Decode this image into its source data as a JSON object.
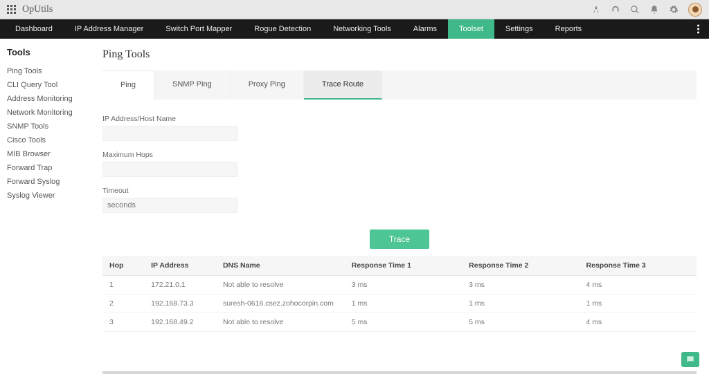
{
  "brand": "OpUtils",
  "nav": {
    "items": [
      "Dashboard",
      "IP Address Manager",
      "Switch Port Mapper",
      "Rogue Detection",
      "Networking Tools",
      "Alarms",
      "Toolset",
      "Settings",
      "Reports"
    ],
    "activeIndex": 6
  },
  "sidebar": {
    "title": "Tools",
    "items": [
      "Ping Tools",
      "CLI Query Tool",
      "Address Monitoring",
      "Network Monitoring",
      "SNMP Tools",
      "Cisco Tools",
      "MIB Browser",
      "Forward Trap",
      "Forward Syslog",
      "Syslog Viewer"
    ]
  },
  "page": {
    "title": "Ping Tools",
    "tabs": [
      "Ping",
      "SNMP Ping",
      "Proxy Ping",
      "Trace Route"
    ],
    "activeTab": 3
  },
  "form": {
    "ip_label": "IP Address/Host Name",
    "ip_value": "",
    "hops_label": "Maximum Hops",
    "hops_value": "",
    "timeout_label": "Timeout",
    "timeout_placeholder": "seconds",
    "trace_label": "Trace"
  },
  "table": {
    "headers": [
      "Hop",
      "IP Address",
      "DNS Name",
      "Response Time 1",
      "Response Time 2",
      "Response Time 3"
    ],
    "rows": [
      {
        "hop": "1",
        "ip": "172.21.0.1",
        "dns": "Not able to resolve",
        "r1": "3 ms",
        "r2": "3 ms",
        "r3": "4 ms"
      },
      {
        "hop": "2",
        "ip": "192.168.73.3",
        "dns": "suresh-0616.csez.zohocorpin.com",
        "r1": "1 ms",
        "r2": "1 ms",
        "r3": "1 ms"
      },
      {
        "hop": "3",
        "ip": "192.168.49.2",
        "dns": "Not able to resolve",
        "r1": "5 ms",
        "r2": "5 ms",
        "r3": "4 ms"
      }
    ]
  }
}
